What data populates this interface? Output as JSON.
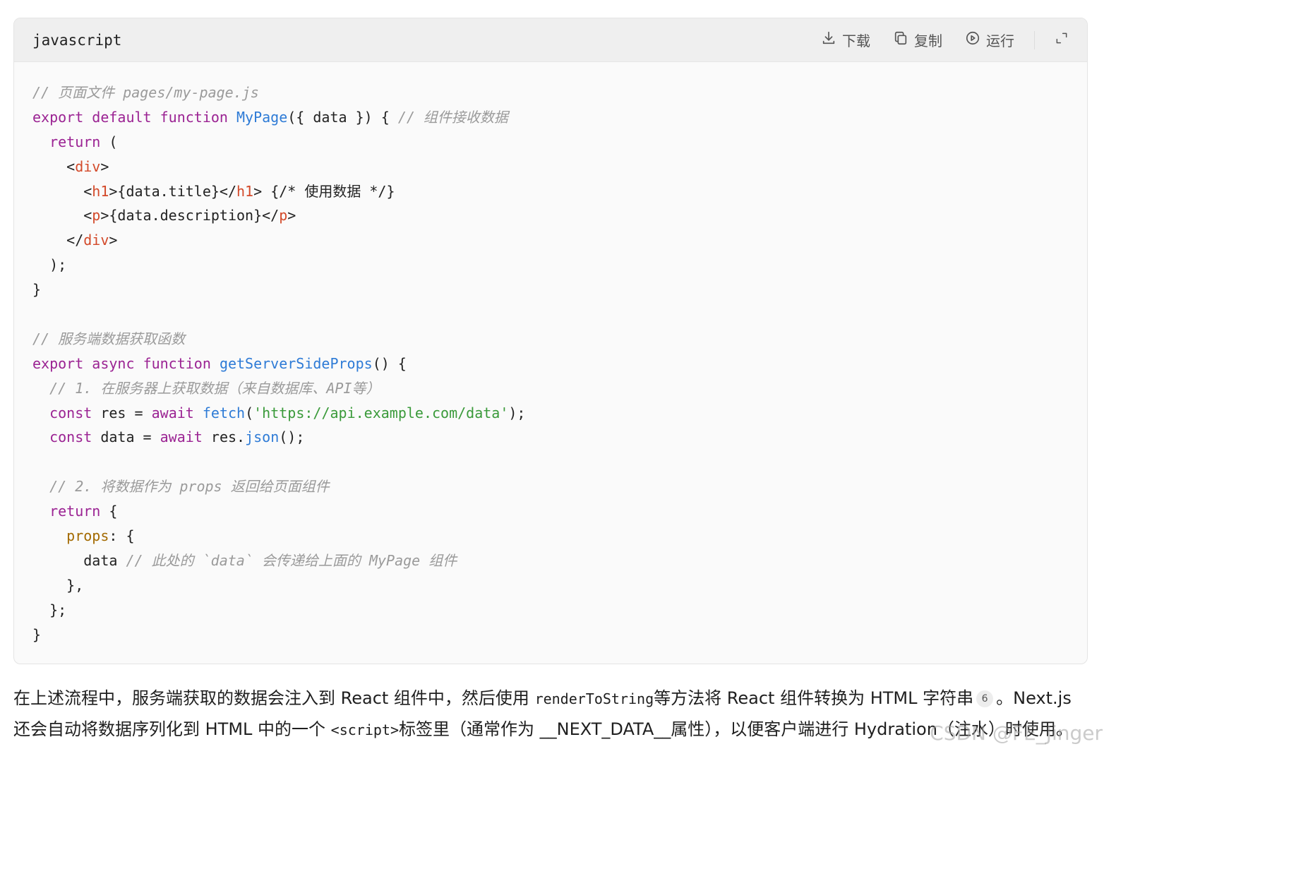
{
  "code_block": {
    "language": "javascript",
    "actions": {
      "download": "下载",
      "copy": "复制",
      "run": "运行"
    },
    "lines": [
      "// 页面文件 pages/my-page.js",
      "export default function MyPage({ data }) { // 组件接收数据",
      "  return (",
      "    <div>",
      "      <h1>{data.title}</h1> {/* 使用数据 */}",
      "      <p>{data.description}</p>",
      "    </div>",
      "  );",
      "}",
      "",
      "// 服务端数据获取函数",
      "export async function getServerSideProps() {",
      "  // 1. 在服务器上获取数据（来自数据库、API等）",
      "  const res = await fetch('https://api.example.com/data');",
      "  const data = await res.json();",
      "",
      "  // 2. 将数据作为 props 返回给页面组件",
      "  return {",
      "    props: {",
      "      data // 此处的 `data` 会传递给上面的 MyPage 组件",
      "    },",
      "  };",
      "}"
    ]
  },
  "paragraph": {
    "part1": "在上述流程中，服务端获取的数据会注入到 React 组件中，然后使用 ",
    "code1": "renderToString",
    "part2": "等方法将 React 组件转换为 HTML 字符串",
    "citation": "6",
    "part3": "。Next.js 还会自动将数据序列化到 HTML 中的一个 ",
    "code2": "<script>",
    "part4": "标签里（通常作为 __NEXT_DATA__属性），以便客户端进行 Hydration（注水）时使用。"
  },
  "watermark": "CSDN @FE_Jinger"
}
